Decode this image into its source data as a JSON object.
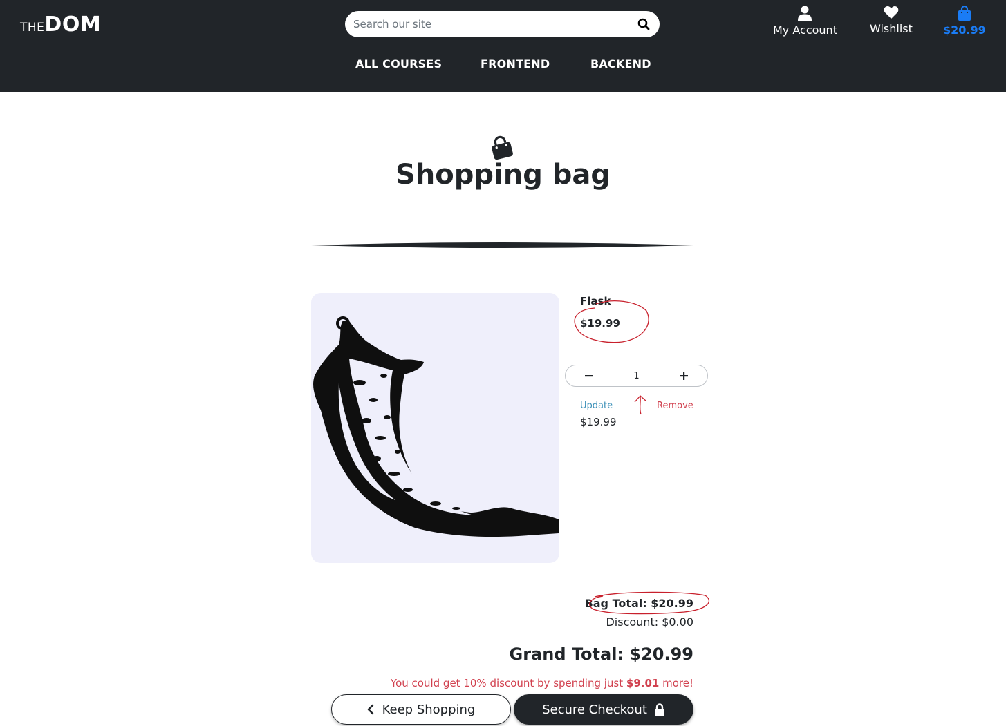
{
  "header": {
    "logo_prefix": "THE",
    "logo_main": "DOM",
    "search_placeholder": "Search our site",
    "account_label": "My Account",
    "wishlist_label": "Wishlist",
    "bag_total": "$20.99",
    "icons": [
      "user-icon",
      "heart-icon",
      "shopping-bag-icon",
      "search-icon"
    ]
  },
  "nav": {
    "items": [
      {
        "label": "ALL COURSES"
      },
      {
        "label": "FRONTEND"
      },
      {
        "label": "BACKEND"
      }
    ]
  },
  "main": {
    "title": "Shopping bag",
    "item": {
      "name": "Flask",
      "price": "$19.99",
      "quantity": "1",
      "update_label": "Update",
      "remove_label": "Remove",
      "subtotal": "$19.99"
    },
    "totals": {
      "bag_total": "Bag Total: $20.99",
      "discount": "Discount: $0.00",
      "grand_total": "Grand Total: $20.99",
      "promo_prefix": "You could get 10% discount by spending just ",
      "promo_amount": "$9.01",
      "promo_suffix": " more!"
    },
    "buttons": {
      "keep_shopping": "Keep Shopping",
      "secure_checkout": "Secure Checkout"
    }
  },
  "colors": {
    "header_bg": "#212529",
    "accent_blue": "#1a7cf5",
    "danger_red": "#d1414f",
    "link_blue": "#3a8fb7",
    "image_bg": "#efeffb"
  }
}
